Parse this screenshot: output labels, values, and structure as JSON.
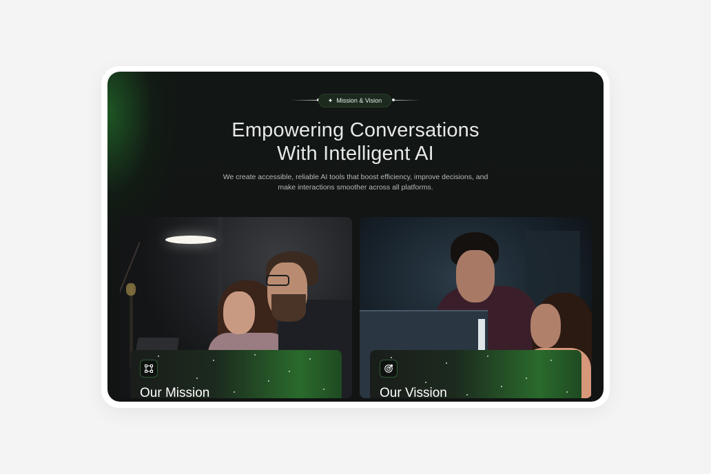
{
  "badge": {
    "label": "Mission & Vision",
    "icon": "sparkle-icon"
  },
  "hero": {
    "title_line1": "Empowering Conversations",
    "title_line2": "With Intelligent AI",
    "subtitle_line1": "We create accessible, reliable AI tools that boost efficiency, improve decisions, and",
    "subtitle_line2": "make interactions smoother across all platforms."
  },
  "cards": [
    {
      "title": "Our Mission",
      "icon": "frame-select-icon"
    },
    {
      "title": "Our Vission",
      "icon": "target-icon"
    }
  ],
  "colors": {
    "background": "#121614",
    "accent": "#2a6a2c",
    "text": "#e6e9e6"
  }
}
